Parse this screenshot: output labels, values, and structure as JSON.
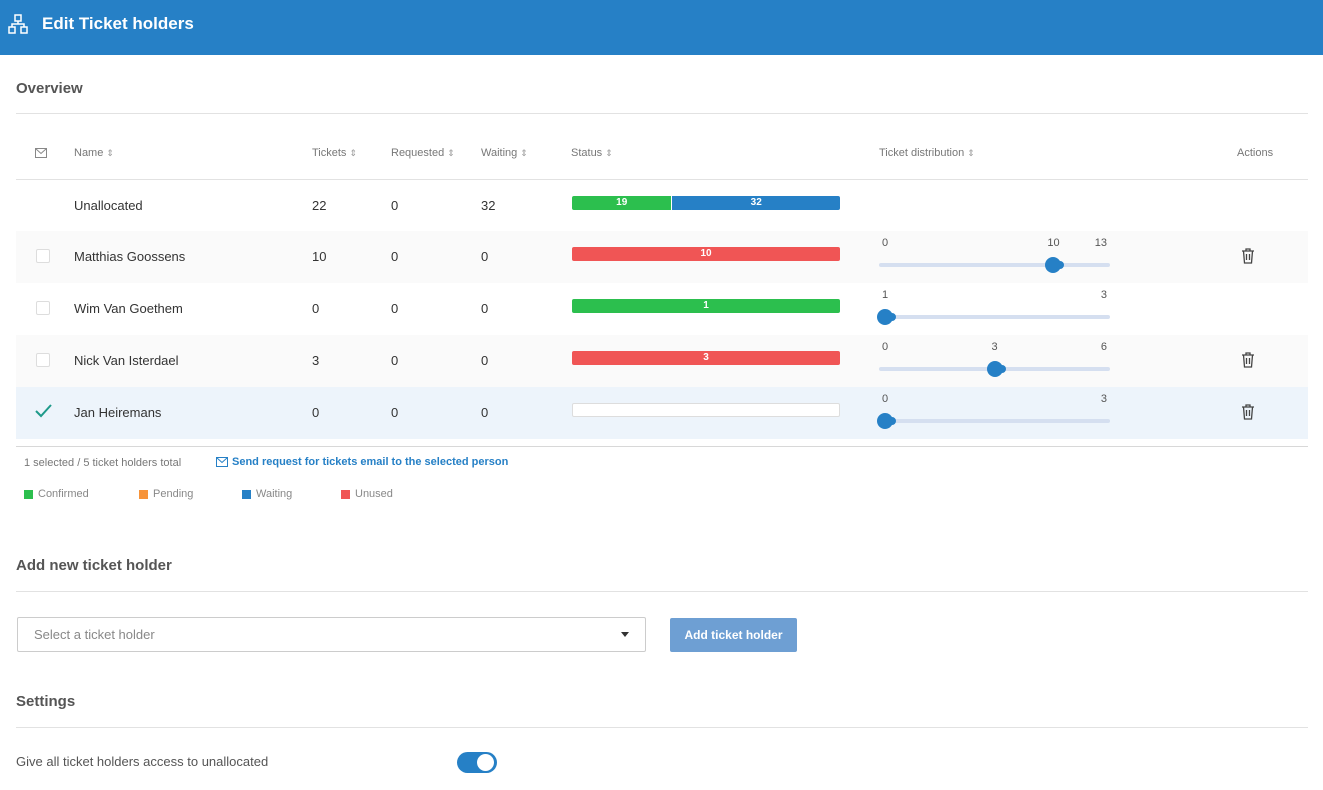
{
  "header": {
    "title": "Edit Ticket holders",
    "icon": "sitemap-icon"
  },
  "overview": {
    "title": "Overview",
    "columns": {
      "name": "Name",
      "tickets": "Tickets",
      "requested": "Requested",
      "waiting": "Waiting",
      "status": "Status",
      "distribution": "Ticket distribution",
      "actions": "Actions"
    },
    "unallocated": {
      "name": "Unallocated",
      "tickets": "22",
      "requested": "0",
      "waiting": "32",
      "status": [
        {
          "type": "confirmed",
          "value": 19,
          "label": "19"
        },
        {
          "type": "waiting",
          "value": 32,
          "label": "32"
        }
      ]
    },
    "rows": [
      {
        "name": "Matthias Goossens",
        "tickets": "10",
        "requested": "0",
        "waiting": "0",
        "checked": false,
        "status": [
          {
            "type": "unused",
            "value": 10,
            "label": "10"
          }
        ],
        "slider": {
          "min": "0",
          "max": "13",
          "value": "10",
          "fraction": 0.7692
        },
        "delete": true
      },
      {
        "name": "Wim Van Goethem",
        "tickets": "0",
        "requested": "0",
        "waiting": "0",
        "checked": false,
        "status": [
          {
            "type": "confirmed",
            "value": 1,
            "label": "1"
          }
        ],
        "slider": {
          "min": "1",
          "max": "3",
          "value": "",
          "fraction": 0
        },
        "delete": false
      },
      {
        "name": "Nick Van Isterdael",
        "tickets": "3",
        "requested": "0",
        "waiting": "0",
        "checked": false,
        "status": [
          {
            "type": "unused",
            "value": 3,
            "label": "3"
          }
        ],
        "slider": {
          "min": "0",
          "max": "6",
          "value": "3",
          "fraction": 0.5
        },
        "delete": true
      },
      {
        "name": "Jan Heiremans",
        "tickets": "0",
        "requested": "0",
        "waiting": "0",
        "checked": true,
        "status": [],
        "slider": {
          "min": "0",
          "max": "3",
          "value": "",
          "fraction": 0
        },
        "delete": true
      }
    ],
    "footer_info": "1 selected / 5 ticket holders total",
    "email_link": "Send request for tickets email to the selected person",
    "legend": [
      {
        "label": "Confirmed",
        "color": "#2cbf4e"
      },
      {
        "label": "Pending",
        "color": "#f7943a"
      },
      {
        "label": "Waiting",
        "color": "#2680c6"
      },
      {
        "label": "Unused",
        "color": "#f05555"
      }
    ]
  },
  "add_holder": {
    "title": "Add new ticket holder",
    "select_placeholder": "Select a ticket holder",
    "button_label": "Add ticket holder"
  },
  "settings": {
    "title": "Settings",
    "access_label": "Give all ticket holders access to unallocated",
    "access_enabled": true
  },
  "colors": {
    "brand": "#2680c6",
    "confirmed": "#2cbf4e",
    "waiting": "#2680c6",
    "unused": "#f05555",
    "pending": "#f7943a"
  }
}
